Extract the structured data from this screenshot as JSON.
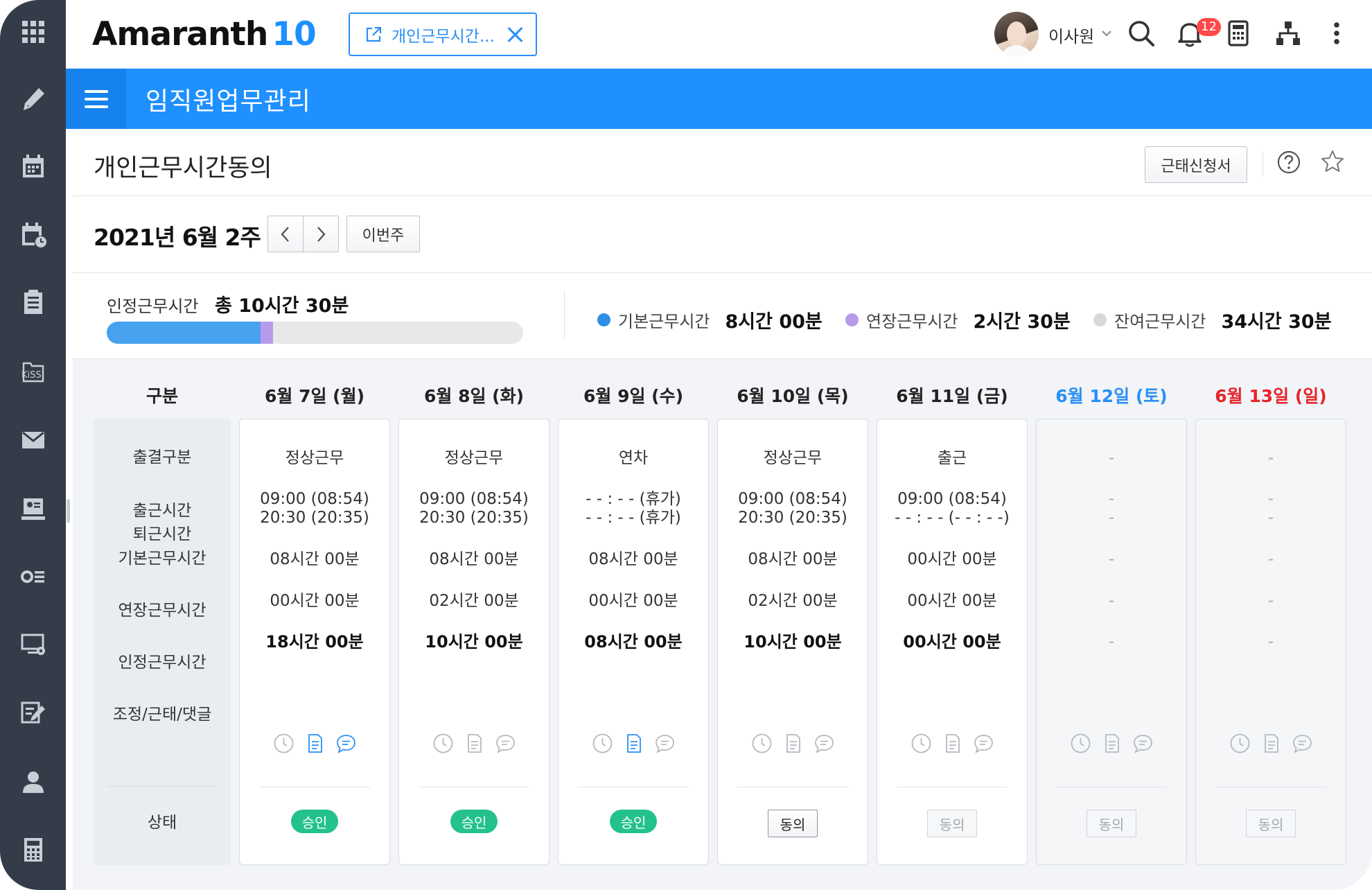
{
  "app": {
    "logo_text": "Amaranth",
    "logo_version": "10"
  },
  "open_tab": {
    "label": "개인근무시간..."
  },
  "user": {
    "name": "이사원",
    "notification_count": "12"
  },
  "module": {
    "title": "임직원업무관리"
  },
  "page": {
    "title": "개인근무시간동의",
    "attendance_button": "근태신청서"
  },
  "week": {
    "label": "2021년 6월 2주",
    "this_week_button": "이번주"
  },
  "summary": {
    "recognized_label": "인정근무시간",
    "recognized_total": "총 10시간 30분",
    "progress": {
      "basic_fraction": 0.37,
      "overtime_fraction": 0.03
    },
    "legend": [
      {
        "label": "기본근무시간",
        "value": "8시간 00분",
        "color": "#2f8fe6"
      },
      {
        "label": "연장근무시간",
        "value": "2시간 30분",
        "color": "#b79bea"
      },
      {
        "label": "잔여근무시간",
        "value": "34시간 30분",
        "color": "#d6d8db"
      }
    ]
  },
  "table": {
    "header_label": "구분",
    "row_labels": [
      "출결구분",
      "출근시간",
      "퇴근시간",
      "기본근무시간",
      "연장근무시간",
      "인정근무시간",
      "조정/근태/댓글",
      "상태"
    ],
    "days": [
      {
        "date": "6월 7일 (월)",
        "type": "정상근무",
        "in": "09:00 (08:54)",
        "out": "20:30 (20:35)",
        "basic": "08시간 00분",
        "overtime": "00시간 00분",
        "recognized": "18시간 00분",
        "status": "승인",
        "doc_active": true,
        "comment_active": true
      },
      {
        "date": "6월 8일 (화)",
        "type": "정상근무",
        "in": "09:00 (08:54)",
        "out": "20:30 (20:35)",
        "basic": "08시간 00분",
        "overtime": "02시간 00분",
        "recognized": "10시간 00분",
        "status": "승인",
        "doc_active": false,
        "comment_active": false
      },
      {
        "date": "6월 9일 (수)",
        "type": "연차",
        "in": "- - : - - (휴가)",
        "out": "- - : - - (휴가)",
        "basic": "08시간 00분",
        "overtime": "00시간 00분",
        "recognized": "08시간 00분",
        "status": "승인",
        "doc_active": true,
        "comment_active": false
      },
      {
        "date": "6월 10일 (목)",
        "type": "정상근무",
        "in": "09:00 (08:54)",
        "out": "20:30 (20:35)",
        "basic": "08시간 00분",
        "overtime": "02시간 00분",
        "recognized": "10시간 00분",
        "status": "동의",
        "doc_active": false,
        "comment_active": false
      },
      {
        "date": "6월 11일 (금)",
        "type": "출근",
        "in": "09:00 (08:54)",
        "out": "- - : - - (- - : - -)",
        "basic": "00시간 00분",
        "overtime": "00시간 00분",
        "recognized": "00시간 00분",
        "status": "동의",
        "doc_active": false,
        "comment_active": false
      },
      {
        "date": "6월 12일 (토)",
        "type": "-",
        "in": "-",
        "out": "-",
        "basic": "-",
        "overtime": "-",
        "recognized": "-",
        "status": "동의",
        "doc_active": false,
        "comment_active": false
      },
      {
        "date": "6월 13일 (일)",
        "type": "-",
        "in": "-",
        "out": "-",
        "basic": "-",
        "overtime": "-",
        "recognized": "-",
        "status": "동의",
        "doc_active": false,
        "comment_active": false
      }
    ]
  },
  "colors": {
    "primary": "#1e90ff",
    "sidebar": "#353c49",
    "approved": "#23c28a",
    "saturday": "#2a8ff7",
    "sunday": "#e8242a",
    "notification": "#ff4a4a"
  }
}
